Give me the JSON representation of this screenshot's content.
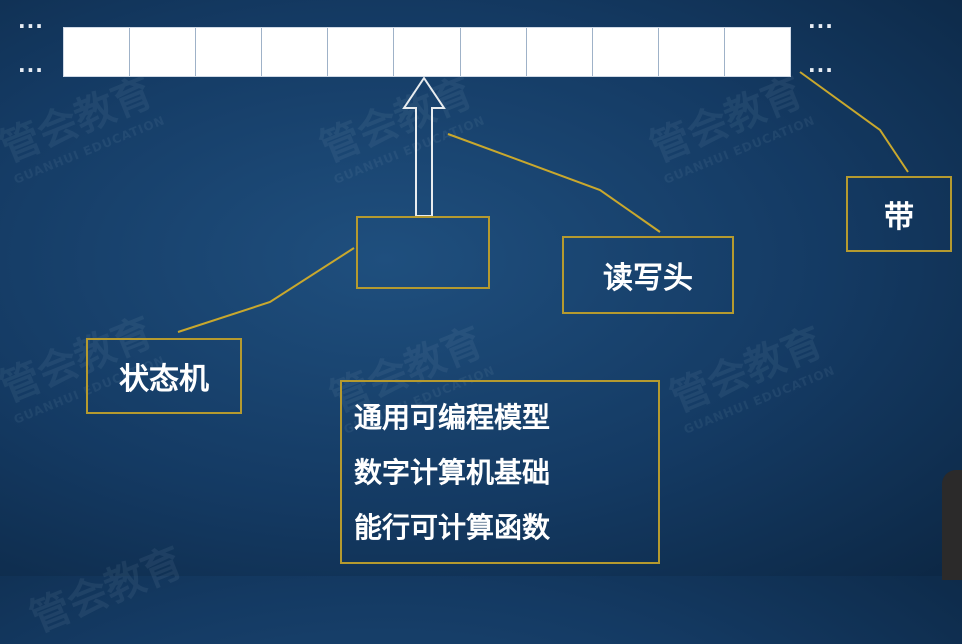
{
  "tape": {
    "cell_count": 11,
    "left_ellipsis_top": "···",
    "left_ellipsis_bottom": "···",
    "right_ellipsis_top": "···",
    "right_ellipsis_bottom": "···"
  },
  "labels": {
    "tape": "带",
    "read_write_head": "读写头",
    "state_machine": "状态机"
  },
  "description": {
    "line1": "通用可编程模型",
    "line2": "数字计算机基础",
    "line3": "能行可计算函数"
  },
  "watermark": {
    "brand": "管会教育",
    "sub": "GUANHUI EDUCATION"
  },
  "colors": {
    "background": "#143a63",
    "accent_border": "#b59a2f",
    "connector_line": "#c9a82d",
    "text": "#ffffff"
  }
}
